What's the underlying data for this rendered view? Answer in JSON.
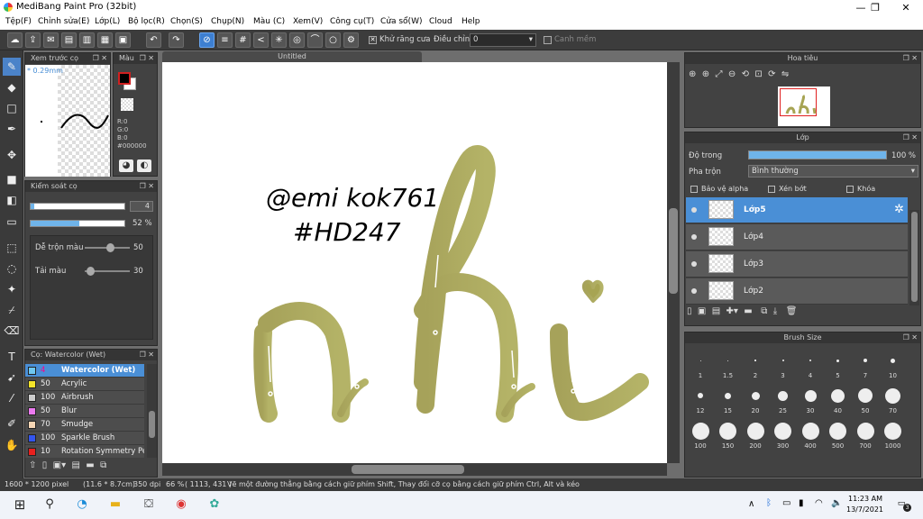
{
  "window": {
    "title": "MediBang Paint Pro (32bit)",
    "min": "—",
    "max": "❐",
    "close": "✕"
  },
  "menu": [
    "Tệp(F)",
    "Chỉnh sửa(E)",
    "Lớp(L)",
    "Bộ lọc(R)",
    "Chọn(S)",
    "Chụp(N)",
    "Màu (C)",
    "Xem(V)",
    "Công cụ(T)",
    "Cửa sổ(W)",
    "Cloud",
    "Help"
  ],
  "toolbar": {
    "antialias_label": "Khử răng cưa",
    "antialias_check": "✕",
    "adjust_label": "Điều chỉnh",
    "adjust_value": "0",
    "edge_label": "Canh mềm"
  },
  "panels": {
    "preview_title": "Xem trước cọ",
    "preview_size": "* 0.29mm",
    "color_title": "Màu",
    "r": "R:0",
    "g": "G:0",
    "b": "B:0",
    "hex": "#000000",
    "brushctl_title": "Kiểm soát cọ",
    "size_value": "4",
    "opacity_value": "52 %",
    "blend_label": "Dễ trộn màu",
    "blend_value": "50",
    "rich_label": "Tải màu",
    "rich_value": "30",
    "brushlist_title": "Cọ: Watercolor (Wet)",
    "nav_title": "Hoa tiêu",
    "layer_title": "Lớp",
    "opacity_label": "Độ trong",
    "opacity_pct": "100 %",
    "blend_mode_label": "Pha trộn",
    "blend_mode_value": "Bình thường",
    "protect_alpha": "Bảo vệ alpha",
    "clipping": "Xén bớt",
    "lock": "Khóa",
    "brushsize_title": "Brush Size"
  },
  "brushes": [
    {
      "size": "4",
      "name": "Watercolor (Wet)",
      "color": "#6fc7ef",
      "sel": true
    },
    {
      "size": "50",
      "name": "Acrylic",
      "color": "#f3e32a"
    },
    {
      "size": "100",
      "name": "Airbrush",
      "color": "#cccccc"
    },
    {
      "size": "50",
      "name": "Blur",
      "color": "#ec7af0"
    },
    {
      "size": "70",
      "name": "Smudge",
      "color": "#f6d6b5"
    },
    {
      "size": "100",
      "name": "Sparkle Brush",
      "color": "#3355ee"
    },
    {
      "size": "10",
      "name": "Rotation Symmetry Pe",
      "color": "#e8201e"
    }
  ],
  "canvas_tab": "Untitled",
  "handwriting": {
    "line1": "@emi kok761",
    "line2": "#HD247"
  },
  "layers": [
    {
      "name": "Lớp5",
      "sel": true
    },
    {
      "name": "Lớp4"
    },
    {
      "name": "Lớp3"
    },
    {
      "name": "Lớp2"
    }
  ],
  "brush_sizes": [
    "1",
    "1.5",
    "2",
    "3",
    "4",
    "5",
    "7",
    "10",
    "12",
    "15",
    "20",
    "25",
    "30",
    "40",
    "50",
    "70",
    "100",
    "150",
    "200",
    "300",
    "400",
    "500",
    "700",
    "1000"
  ],
  "status": {
    "dims": "1600 * 1200 pixel",
    "cm": "(11.6 * 8.7cm)",
    "dpi": "350 dpi",
    "zoom": "66 %",
    "coords": "( 1113, 431 )",
    "hint": "Vẽ một đường thẳng bằng cách giữ phím Shift, Thay đổi cỡ cọ bằng cách giữ phím Ctrl, Alt và kéo"
  },
  "taskbar": {
    "time": "11:23 AM",
    "date": "13/7/2021",
    "notif": "3",
    "chevron": "∧"
  },
  "colors": {
    "accent": "#4a8fd6",
    "ink": "#a7a453"
  }
}
